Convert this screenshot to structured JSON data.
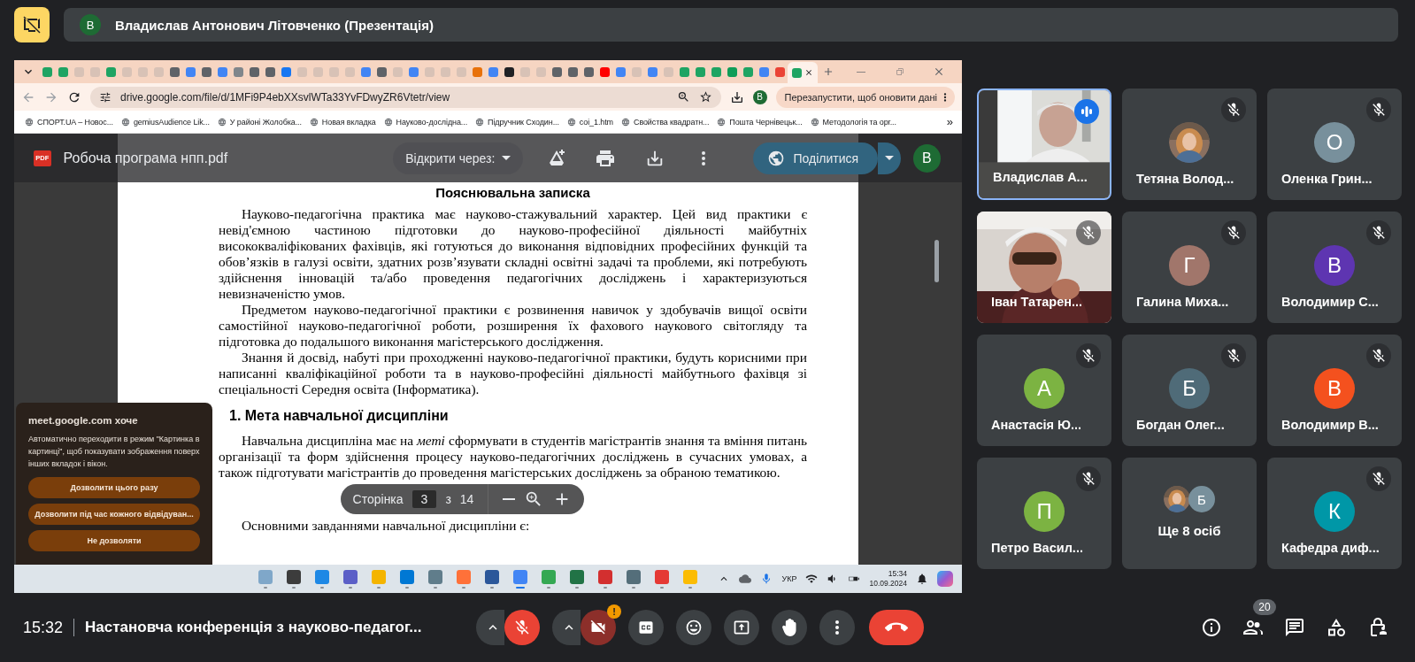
{
  "meet_header": {
    "title": "Владислав Антонович Літовченко (Презентація)",
    "avatar": "В"
  },
  "shared_screen": {
    "browser": {
      "tabs": [
        {
          "color": "#1fa463",
          "selected": false
        },
        {
          "color": "#1fa463",
          "selected": false
        },
        {
          "color": "#d8c2b6",
          "selected": false
        },
        {
          "color": "#d8c2b6",
          "selected": false
        },
        {
          "color": "#1fa463",
          "selected": false
        },
        {
          "color": "#d8c2b6",
          "selected": false
        },
        {
          "color": "#d8c2b6",
          "selected": false
        },
        {
          "color": "#d8c2b6",
          "selected": false
        },
        {
          "color": "#5f6368",
          "selected": false
        },
        {
          "color": "#4285f4",
          "selected": false
        },
        {
          "color": "#5f6368",
          "selected": false
        },
        {
          "color": "#4285f4",
          "selected": false
        },
        {
          "color": "#80868b",
          "selected": false
        },
        {
          "color": "#5f6368",
          "selected": false
        },
        {
          "color": "#5f6368",
          "selected": false
        },
        {
          "color": "#1877f2",
          "selected": false
        },
        {
          "color": "#d8c2b6",
          "selected": false
        },
        {
          "color": "#d8c2b6",
          "selected": false
        },
        {
          "color": "#d8c2b6",
          "selected": false
        },
        {
          "color": "#d8c2b6",
          "selected": false
        },
        {
          "color": "#4285f4",
          "selected": false
        },
        {
          "color": "#5f6368",
          "selected": false
        },
        {
          "color": "#d8c2b6",
          "selected": false
        },
        {
          "color": "#4285f4",
          "selected": false
        },
        {
          "color": "#d8c2b6",
          "selected": false
        },
        {
          "color": "#d8c2b6",
          "selected": false
        },
        {
          "color": "#d8c2b6",
          "selected": false
        },
        {
          "color": "#e8710a",
          "selected": false
        },
        {
          "color": "#4285f4",
          "selected": false
        },
        {
          "color": "#202124",
          "selected": false
        },
        {
          "color": "#d8c2b6",
          "selected": false
        },
        {
          "color": "#d8c2b6",
          "selected": false
        },
        {
          "color": "#5f6368",
          "selected": false
        },
        {
          "color": "#5f6368",
          "selected": false
        },
        {
          "color": "#5f6368",
          "selected": false
        },
        {
          "color": "#ff0000",
          "selected": false
        },
        {
          "color": "#4285f4",
          "selected": false
        },
        {
          "color": "#d8c2b6",
          "selected": false
        },
        {
          "color": "#4285f4",
          "selected": false
        },
        {
          "color": "#d8c2b6",
          "selected": false
        },
        {
          "color": "#1fa463",
          "selected": false
        },
        {
          "color": "#1fa463",
          "selected": false
        },
        {
          "color": "#1fa463",
          "selected": false
        },
        {
          "color": "#0f9d58",
          "selected": false
        },
        {
          "color": "#1fa463",
          "selected": false
        },
        {
          "color": "#4285f4",
          "selected": false
        },
        {
          "color": "#ea4335",
          "selected": false
        },
        {
          "color": "#1fa463",
          "selected": true
        }
      ],
      "address": "drive.google.com/file/d/1MFi9P4ebXXsvlWTa33YvFDwyZR6Vtetr/view",
      "profile": "В",
      "update_button": "Перезапустити, щоб оновити дані",
      "bookmarks": [
        "СПОРТ.UA – Новос...",
        "gemiusAudience Lik...",
        "У районі Жолобка...",
        "Новая вкладка",
        "Науково-дослідна...",
        "Підручник Сходин...",
        "coi_1.htm",
        "Свойства квадратн...",
        "Пошта Чернівецьк...",
        "Методологія та орг..."
      ],
      "bookmarks_more": "»"
    },
    "pdf_viewer": {
      "file_badge": "PDF",
      "file_name": "Робоча програма нпп.pdf",
      "open_with": "Відкрити через:",
      "share": "Поділитися",
      "avatar": "В",
      "document": {
        "title": "Пояснювальна записка",
        "blocks": [
          {
            "kind": "paragraph",
            "text": "Науково-педагогічна практика має науково-стажувальний характер. Цей вид практики є невід'ємною частиною підготовки до науково-професійної діяльності майбутніх висококваліфікованих фахівців, які готуються до виконання відповідних професійних функцій та обов’язків в галузі освіти, здатних розв’язувати складні освітні задачі та проблеми, які потребують здійснення інновацій та/або проведення педагогічних досліджень і характеризуються невизначеністю умов."
          },
          {
            "kind": "paragraph",
            "text": "Предметом науково-педагогічної практики є розвинення навичок у здобувачів вищої освіти самостійної науково-педагогічної роботи, розширення їх фахового наукового світогляду та підготовка до подальшого виконання магістерського дослідження."
          },
          {
            "kind": "paragraph",
            "text": "Знання й досвід, набуті при проходженні науково-педагогічної практики, будуть корисними при написанні кваліфікаційної роботи та в науково-професійні діяльності майбутнього фахівця зі спеціальності Середня освіта (Інформатика)."
          },
          {
            "kind": "heading",
            "text": "1.  Мета навчальної дисципліни"
          },
          {
            "kind": "paragraph",
            "text": "Навчальна дисципліна має на *меті* сформувати в студентів магістрантів знання та вміння питань організації та форм здійснення процесу науково-педагогічних досліджень в сучасних умовах, а також підготувати магістрантів до проведення магістерських досліджень за обраною тематикою."
          },
          {
            "kind": "page_nav"
          },
          {
            "kind": "paragraph",
            "text": "Основними завданнями навчальної дисципліни є:"
          }
        ]
      },
      "page_nav": {
        "label": "Сторінка",
        "page": "3",
        "of": "з",
        "total": "14"
      }
    },
    "permission_popup": {
      "title": "meet.google.com хоче",
      "message": "Автоматично переходити в режим \"Картинка в картинці\", щоб показувати зображення поверх інших вкладок і вікон.",
      "buttons": [
        "Дозволити цього разу",
        "Дозволити під час кожного відвідуван...",
        "Не дозволяти"
      ]
    },
    "taskbar": {
      "apps": [
        {
          "color": "#7fa7c9",
          "selected": false
        },
        {
          "color": "#3c3c3c",
          "selected": false
        },
        {
          "color": "#1e88e5",
          "selected": false
        },
        {
          "color": "#5b5fc7",
          "selected": false
        },
        {
          "color": "#f4b400",
          "selected": false
        },
        {
          "color": "#0078d4",
          "selected": false
        },
        {
          "color": "#607d8b",
          "selected": false
        },
        {
          "color": "#ff7139",
          "selected": false
        },
        {
          "color": "#2b579a",
          "selected": false
        },
        {
          "color": "#4285f4",
          "selected": true
        },
        {
          "color": "#34a853",
          "selected": false
        },
        {
          "color": "#217346",
          "selected": false
        },
        {
          "color": "#d32f2f",
          "selected": false
        },
        {
          "color": "#546e7a",
          "selected": false
        },
        {
          "color": "#e53935",
          "selected": false
        },
        {
          "color": "#fbbc04",
          "selected": false
        }
      ],
      "language": "УКР",
      "time": "15:34",
      "date": "10.09.2024"
    }
  },
  "participants": [
    {
      "kind": "video",
      "name": "Владислав А...",
      "muted": false,
      "speaking": true
    },
    {
      "name": "Тетяна Волод...",
      "muted": true,
      "speaking": false
    },
    {
      "kind": "avatar",
      "name": "Оленка Грин...",
      "initial": "О",
      "color": "#78909c",
      "muted": true,
      "speaking": false
    },
    {
      "kind": "video",
      "name": "Іван Татарен...",
      "muted": true,
      "speaking": false
    },
    {
      "kind": "avatar",
      "name": "Галина Миха...",
      "initial": "Г",
      "color": "#a1766b",
      "muted": true,
      "speaking": false
    },
    {
      "kind": "avatar",
      "name": "Володимир С...",
      "initial": "В",
      "color": "#5e35b1",
      "muted": true,
      "speaking": false
    },
    {
      "kind": "avatar",
      "name": "Анастасія Ю...",
      "initial": "А",
      "color": "#7cb342",
      "muted": true,
      "speaking": false
    },
    {
      "kind": "avatar",
      "name": "Богдан Олег...",
      "initial": "Б",
      "color": "#4f6b78",
      "muted": true,
      "speaking": false
    },
    {
      "kind": "avatar",
      "name": "Володимир В...",
      "initial": "В",
      "color": "#f4511e",
      "muted": true,
      "speaking": false
    },
    {
      "kind": "avatar",
      "name": "Петро Васил...",
      "initial": "П",
      "color": "#7cb342",
      "muted": true,
      "speaking": false
    },
    {
      "kind": "more",
      "name": "Ще 8 осіб",
      "initial": "Б",
      "color": "#78909c",
      "muted": false,
      "speaking": false
    },
    {
      "kind": "avatar",
      "name": "Кафедра диф...",
      "initial": "К",
      "color": "#0097a7",
      "muted": true,
      "speaking": false
    }
  ],
  "bottom_bar": {
    "time": "15:32",
    "meeting_title": "Настановча конференція з науково-педагог...",
    "controls": [
      {
        "kind": "mic",
        "on": false
      },
      {
        "kind": "camera",
        "on": false,
        "alert": "!"
      },
      {
        "kind": "captions",
        "on": false
      },
      {
        "kind": "reactions"
      },
      {
        "kind": "present"
      },
      {
        "kind": "hand",
        "on": false
      },
      {
        "kind": "more"
      },
      {
        "kind": "leave"
      }
    ],
    "side_buttons": [
      {
        "kind": "info"
      },
      {
        "kind": "people",
        "badge": "20"
      },
      {
        "kind": "chat"
      },
      {
        "kind": "activities"
      },
      {
        "kind": "host"
      }
    ]
  }
}
